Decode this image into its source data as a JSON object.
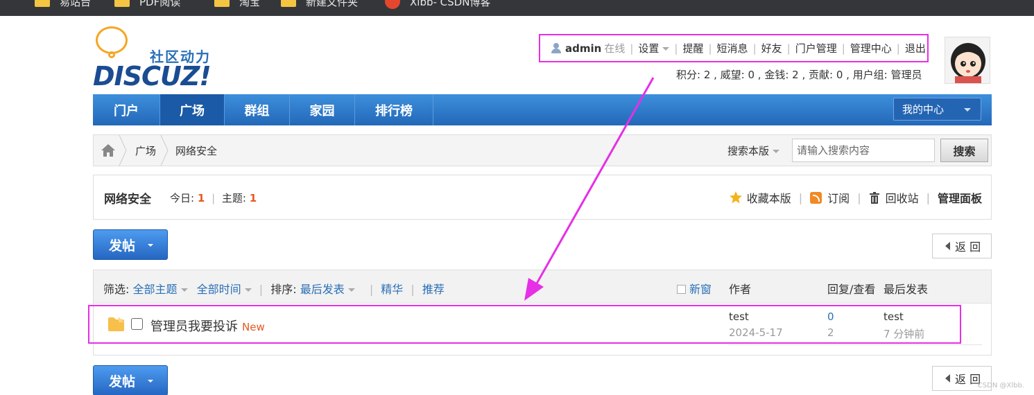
{
  "bookmarks": [
    {
      "label": "易站台",
      "icon": "folder-icon"
    },
    {
      "label": "PDF阅读",
      "icon": "folder-icon"
    },
    {
      "label": "淘宝",
      "icon": "folder-icon"
    },
    {
      "label": "新建文件夹",
      "icon": "folder-icon"
    },
    {
      "label": "Xlbb- CSDN博客",
      "icon": "csdn-icon"
    }
  ],
  "logo": {
    "cn": "社区动力",
    "en": "DISCUZ!"
  },
  "userbar": {
    "username": "admin",
    "status": "在线",
    "settings": "设置",
    "remind": "提醒",
    "messages": "短消息",
    "friends": "好友",
    "portal_manage": "门户管理",
    "admin_center": "管理中心",
    "logout": "退出"
  },
  "credits": "积分: 2 , 威望: 0 , 金钱: 2 , 贡献: 0 , 用户组: 管理员",
  "nav": {
    "items": [
      "门户",
      "广场",
      "群组",
      "家园",
      "排行榜"
    ],
    "active": "广场",
    "my_center": "我的中心"
  },
  "breadcrumb": {
    "items": [
      "广场",
      "网络安全"
    ],
    "search_scope": "搜索本版",
    "search_placeholder": "请输入搜索内容",
    "search_button": "搜索"
  },
  "forum": {
    "name": "网络安全",
    "today_label": "今日:",
    "today_value": "1",
    "topics_label": "主题:",
    "topics_value": "1",
    "favorite": "收藏本版",
    "subscribe": "订阅",
    "recycle": "回收站",
    "manage_panel": "管理面板"
  },
  "post_button": "发帖",
  "back_button": "返 回",
  "list_header": {
    "filter_label": "筛选:",
    "all_topics": "全部主题",
    "all_time": "全部时间",
    "sort_label": "排序:",
    "sort_value": "最后发表",
    "digest": "精华",
    "recommend": "推荐",
    "new_window": "新窗",
    "author": "作者",
    "replies_views": "回复/查看",
    "last_post": "最后发表"
  },
  "threads": [
    {
      "title": "管理员我要投诉",
      "badge": "New",
      "author": "test",
      "date": "2024-5-17",
      "replies": "0",
      "views": "2",
      "last_user": "test",
      "last_time": "7 分钟前"
    }
  ],
  "watermark": "CSDN @Xlbb.",
  "colors": {
    "annotation": "#e62fe6",
    "nav_blue": "#2368b8",
    "accent_orange": "#e6581f",
    "link_blue": "#2a6fb6"
  }
}
